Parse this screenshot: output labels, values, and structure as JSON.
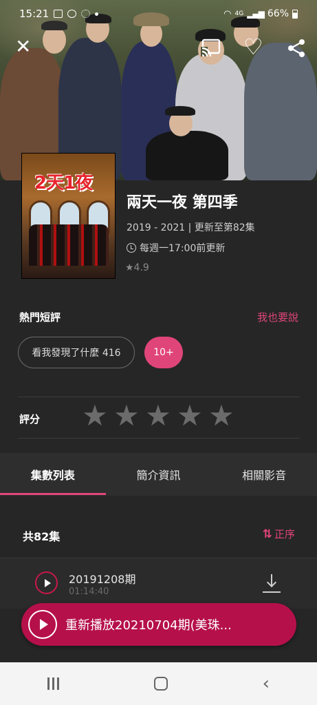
{
  "status_bar": {
    "time": "15:21",
    "network": "4G",
    "battery": "66%"
  },
  "top_actions": {
    "close": "✕",
    "cast": "cast",
    "favorite": "♡",
    "share": "share"
  },
  "show": {
    "poster_logo": "2天1夜",
    "title": "兩天一夜 第四季",
    "years_and_update": "2019 - 2021 | 更新至第82集",
    "schedule": "每週一17:00前更新",
    "rating": "★4.9"
  },
  "comments": {
    "heading": "熱門短評",
    "write_link": "我也要說",
    "chip": "看我發現了什麼 416",
    "more_chip": "10+"
  },
  "score": {
    "label": "評分",
    "stars": [
      "★",
      "★",
      "★",
      "★",
      "★"
    ]
  },
  "tabs": [
    {
      "label": "集數列表",
      "active": true
    },
    {
      "label": "簡介資訊",
      "active": false
    },
    {
      "label": "相關影音",
      "active": false
    }
  ],
  "episodes": {
    "total": "共82集",
    "sort_label": "正序",
    "sort_icon": "⇅",
    "items": [
      {
        "title": "20191208期",
        "duration": "01:14:40"
      }
    ]
  },
  "resume_button": {
    "label": "重新播放20210704期(美珠..."
  },
  "colors": {
    "accent": "#e0457a",
    "resume_bg": "#b5104a",
    "background": "#262626"
  }
}
